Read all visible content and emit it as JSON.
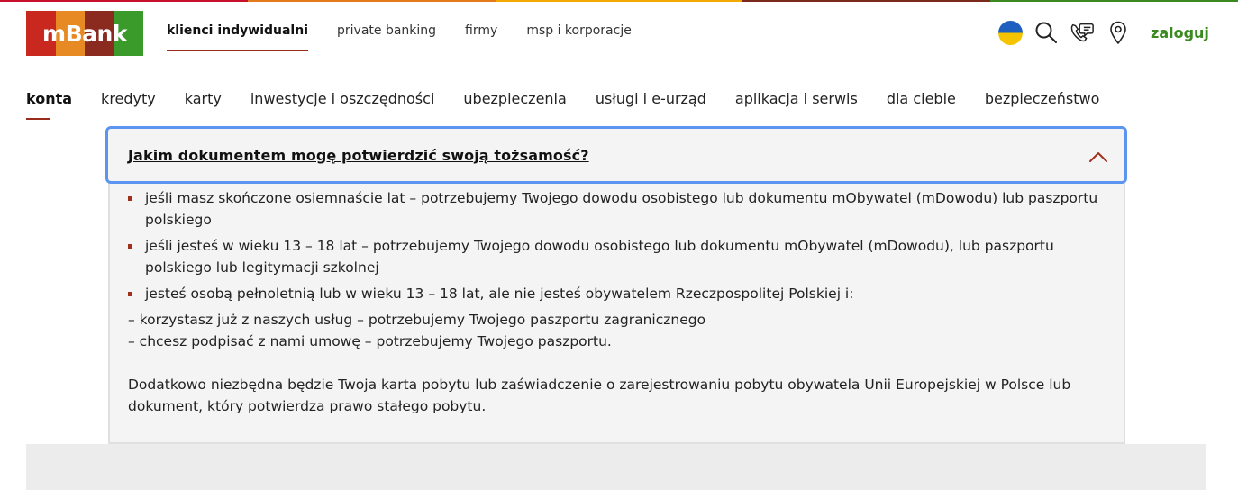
{
  "colors": {
    "accent_red": "#9b2b1a",
    "login_green": "#3a8a1f",
    "focus_blue": "#5b95f0",
    "panel_bg": "#f4f4f4"
  },
  "top_stripe": [
    "#c8102e",
    "#e57a1d",
    "#f2a900",
    "#7a2a1c",
    "#3a8a1f"
  ],
  "logo": {
    "text": "mBank",
    "colors": [
      "#c8281e",
      "#e88a23",
      "#8b2a1e",
      "#3a9a2a"
    ]
  },
  "segments": [
    {
      "label": "klienci indywidualni",
      "active": true
    },
    {
      "label": "private banking",
      "active": false
    },
    {
      "label": "firmy",
      "active": false
    },
    {
      "label": "msp i korporacje",
      "active": false
    }
  ],
  "tools": {
    "flag_icon": "ukraine-flag-icon",
    "search_icon": "search-icon",
    "phone_icon": "phone-chat-icon",
    "location_icon": "location-pin-icon",
    "login_label": "zaloguj"
  },
  "main_nav": [
    {
      "label": "konta",
      "active": true
    },
    {
      "label": "kredyty",
      "active": false
    },
    {
      "label": "karty",
      "active": false
    },
    {
      "label": "inwestycje i oszczędności",
      "active": false
    },
    {
      "label": "ubezpieczenia",
      "active": false
    },
    {
      "label": "usługi i e-urząd",
      "active": false
    },
    {
      "label": "aplikacja i serwis",
      "active": false
    },
    {
      "label": "dla ciebie",
      "active": false
    },
    {
      "label": "bezpieczeństwo",
      "active": false
    }
  ],
  "accordion": {
    "question": "Jakim dokumentem mogę potwierdzić swoją tożsamość?",
    "expanded": true,
    "bullets": [
      "jeśli masz skończone osiemnaście lat – potrzebujemy Twojego dowodu osobistego lub dokumentu mObywatel (mDowodu) lub paszportu polskiego",
      "jeśli jesteś w wieku 13 – 18 lat – potrzebujemy Twojego dowodu osobistego lub dokumentu mObywatel (mDowodu), lub paszportu polskiego lub legitymacji szkolnej",
      "jesteś osobą pełnoletnią lub w wieku 13 – 18 lat, ale nie jesteś obywatelem Rzeczpospolitej Polskiej i:"
    ],
    "dash_lines": [
      "– korzystasz już z naszych usług – potrzebujemy Twojego paszportu zagranicznego",
      "– chcesz podpisać z nami umowę – potrzebujemy Twojego paszportu."
    ],
    "extra": "Dodatkowo niezbędna będzie Twoja karta pobytu lub zaświadczenie o zarejestrowaniu pobytu obywatela Unii Europejskiej w Polsce lub dokument, który potwierdza prawo stałego pobytu."
  }
}
